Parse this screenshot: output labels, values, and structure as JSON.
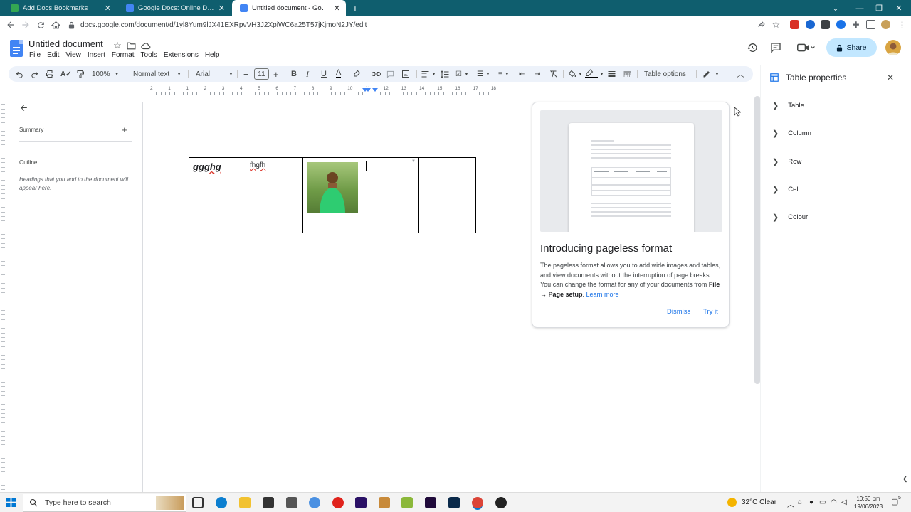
{
  "browser": {
    "tabs": [
      {
        "title": "Add Docs Bookmarks",
        "color": "#34a853"
      },
      {
        "title": "Google Docs: Online Document E",
        "color": "#4285f4"
      },
      {
        "title": "Untitled document - Google Docs",
        "color": "#4285f4"
      }
    ],
    "new_tab": "+",
    "url": "docs.google.com/document/d/1yl8Yum9lJX41EXRpvVH3J2XpiWC6a25T57jKjmoN2JY/edit"
  },
  "doc": {
    "title": "Untitled document",
    "menus": [
      "File",
      "Edit",
      "View",
      "Insert",
      "Format",
      "Tools",
      "Extensions",
      "Help"
    ],
    "share_label": "Share"
  },
  "toolbar": {
    "zoom": "100%",
    "style": "Normal text",
    "font": "Arial",
    "font_size": "11",
    "table_options": "Table options"
  },
  "ruler": {
    "numbers": [
      "2",
      "1",
      "1",
      "2",
      "3",
      "4",
      "5",
      "6",
      "7",
      "8",
      "9",
      "10",
      "11",
      "12",
      "13",
      "14",
      "15",
      "16",
      "17",
      "18"
    ]
  },
  "outline": {
    "summary_label": "Summary",
    "outline_label": "Outline",
    "hint": "Headings that you add to the document will appear here."
  },
  "table": {
    "cell1": "ggghg",
    "cell2": "fhgfh"
  },
  "popup": {
    "title": "Introducing pageless format",
    "body_1": "The pageless format allows you to add wide images and tables, and view documents without the interruption of page breaks. You can change the format for any of your documents from ",
    "body_bold": "File → Page setup",
    "body_2": ". ",
    "learn_more": "Learn more",
    "dismiss": "Dismiss",
    "try_it": "Try it"
  },
  "side_panel": {
    "title": "Table properties",
    "items": [
      "Table",
      "Column",
      "Row",
      "Cell",
      "Colour"
    ]
  },
  "taskbar": {
    "search_placeholder": "Type here to search",
    "weather": "32°C  Clear",
    "time": "10:50 pm",
    "date": "19/06/2023",
    "notifications": "5"
  }
}
